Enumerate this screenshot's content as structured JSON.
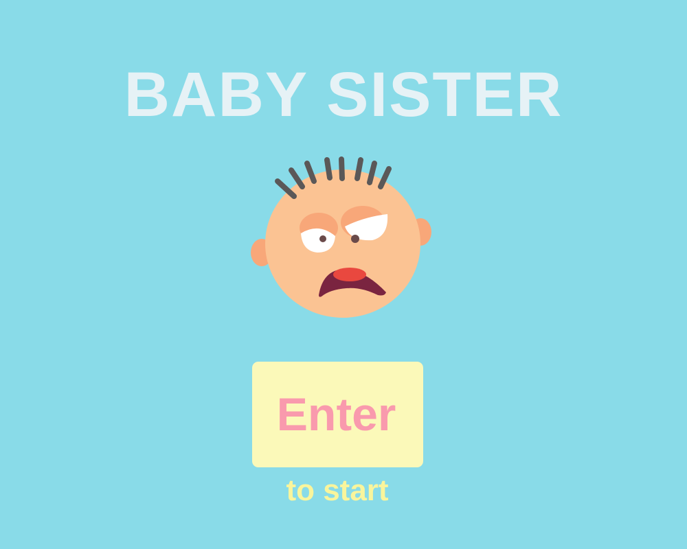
{
  "game": {
    "title": "BABY SISTER",
    "start_button_label": "Enter",
    "start_hint": "to start"
  },
  "icons": {
    "mascot": "angry-baby-face-icon"
  },
  "colors": {
    "background": "#89dbe8",
    "title": "#e6f2f6",
    "button_background": "#fbf9b9",
    "button_text": "#f99aad",
    "hint_text": "#f9f59c",
    "skin": "#fbc393",
    "hair": "#5b5858"
  }
}
